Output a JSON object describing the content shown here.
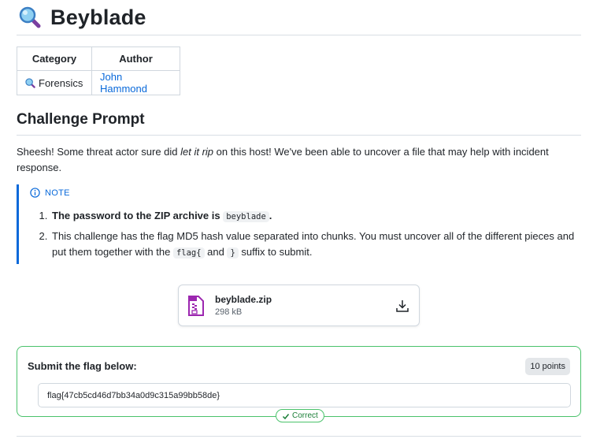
{
  "page": {
    "title": "Beyblade",
    "title_icon": "magnifying-glass-icon"
  },
  "meta_table": {
    "headers": [
      "Category",
      "Author"
    ],
    "category": "Forensics",
    "category_icon": "magnifying-glass-icon",
    "author": "John Hammond"
  },
  "prompt": {
    "heading": "Challenge Prompt",
    "text_before": "Sheesh! Some threat actor sure did ",
    "text_italic": "let it rip",
    "text_after": " on this host! We've been able to uncover a file that may help with incident response."
  },
  "note": {
    "label": "NOTE",
    "icon": "info-icon",
    "item1_text": "The password to the ZIP archive is ",
    "item1_code": "beyblade",
    "item1_end": ".",
    "item2_text": "This challenge has the flag MD5 hash value separated into chunks. You must uncover all of the different pieces and put them together with the ",
    "item2_code1": "flag{",
    "item2_mid": " and ",
    "item2_code2": "}",
    "item2_end": " suffix to submit."
  },
  "file": {
    "name": "beyblade.zip",
    "size": "298 kB",
    "icon": "zip-file-icon",
    "download_icon": "download-icon"
  },
  "flag_submit": {
    "label": "Submit the flag below:",
    "points": "10 points",
    "value": "flag{47cb5cd46d7bb34a0d9c315a99bb58de}",
    "status": "Correct",
    "colors": {
      "accent": "#4ac26b",
      "link": "#0969da"
    }
  }
}
